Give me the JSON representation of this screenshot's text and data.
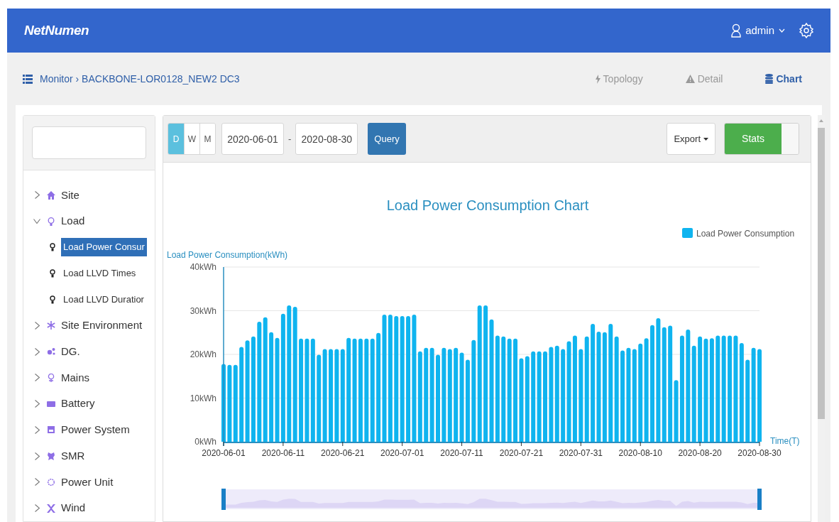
{
  "header": {
    "logo": "NetNumen",
    "user": "admin"
  },
  "breadcrumb": {
    "root": "Monitor",
    "separator": "›",
    "current": "BACKBONE-LOR0128_NEW2 DC3"
  },
  "views": [
    {
      "label": "Topology",
      "selected": false
    },
    {
      "label": "Detail",
      "selected": false
    },
    {
      "label": "Chart",
      "selected": true
    }
  ],
  "tree": [
    {
      "label": "Site",
      "expanded": false
    },
    {
      "label": "Load",
      "expanded": true,
      "children": [
        {
          "label": "Load Power Consur",
          "selected": true
        },
        {
          "label": "Load LLVD Times",
          "selected": false
        },
        {
          "label": "Load LLVD Duratior",
          "selected": false
        }
      ]
    },
    {
      "label": "Site Environment",
      "expanded": false
    },
    {
      "label": "DG.",
      "expanded": false
    },
    {
      "label": "Mains",
      "expanded": false
    },
    {
      "label": "Battery",
      "expanded": false
    },
    {
      "label": "Power System",
      "expanded": false
    },
    {
      "label": "SMR",
      "expanded": false
    },
    {
      "label": "Power Unit",
      "expanded": false
    },
    {
      "label": "Wind",
      "expanded": false
    }
  ],
  "periods": [
    {
      "label": "D",
      "selected": true
    },
    {
      "label": "W",
      "selected": false
    },
    {
      "label": "M",
      "selected": false
    }
  ],
  "date_from": "2020-06-01",
  "date_separator": "-",
  "date_to": "2020-08-30",
  "query_button": "Query",
  "export_button": "Export",
  "stats_toggle": {
    "label": "Stats",
    "on": true
  },
  "chart_data": {
    "type": "bar",
    "title": "Load Power Consumption Chart",
    "xlabel": "Time(T)",
    "ylabel": "Load Power Consumption(kWh)",
    "grid": true,
    "categories": [
      "2020-06-01",
      null,
      null,
      null,
      null,
      null,
      null,
      null,
      null,
      null,
      "2020-06-11",
      null,
      null,
      null,
      null,
      null,
      null,
      null,
      null,
      null,
      "2020-06-21",
      null,
      null,
      null,
      null,
      null,
      null,
      null,
      null,
      null,
      "2020-07-01",
      null,
      null,
      null,
      null,
      null,
      null,
      null,
      null,
      null,
      "2020-07-11",
      null,
      null,
      null,
      null,
      null,
      null,
      null,
      null,
      null,
      "2020-07-21",
      null,
      null,
      null,
      null,
      null,
      null,
      null,
      null,
      null,
      "2020-07-31",
      null,
      null,
      null,
      null,
      null,
      null,
      null,
      null,
      null,
      "2020-08-10",
      null,
      null,
      null,
      null,
      null,
      null,
      null,
      null,
      null,
      "2020-08-20",
      null,
      null,
      null,
      null,
      null,
      null,
      null,
      null,
      null,
      "2020-08-30"
    ],
    "ylim": [
      0,
      40
    ],
    "yticks": [
      {
        "value": 0,
        "label": "0kWh"
      },
      {
        "value": 10,
        "label": "10kWh"
      },
      {
        "value": 20,
        "label": "20kWh"
      },
      {
        "value": 30,
        "label": "30kWh"
      },
      {
        "value": 40,
        "label": "40kWh"
      }
    ],
    "series": [
      {
        "name": "Load Power Consumption",
        "color": "#0fb4ef",
        "values": [
          17.8,
          17.6,
          17.6,
          21.7,
          23.2,
          24.1,
          27.5,
          28.5,
          25.1,
          23.8,
          29.3,
          31.2,
          30.9,
          23.6,
          23.6,
          23.6,
          19.9,
          21.2,
          21.2,
          21.2,
          21.2,
          23.8,
          23.6,
          23.6,
          23.6,
          23.6,
          24.9,
          29.1,
          29.1,
          28.8,
          28.8,
          28.8,
          29.1,
          20.7,
          21.5,
          21.5,
          19.9,
          21.5,
          21.2,
          21.5,
          20.4,
          18.8,
          23.3,
          31.2,
          31.2,
          28,
          24.3,
          24.1,
          23.6,
          23.6,
          19.1,
          19.6,
          20.7,
          20.7,
          20.7,
          21.7,
          22,
          21.2,
          23,
          24.3,
          21.2,
          24.1,
          27,
          25.2,
          25.1,
          27,
          24.1,
          20.9,
          21.5,
          21.2,
          22.5,
          23.7,
          26.7,
          28.3,
          26.2,
          26.6,
          14.1,
          24.3,
          25.7,
          22,
          24.1,
          23.6,
          23.7,
          24.3,
          24.3,
          24.3,
          24.3,
          22.6,
          18.8,
          21.5,
          21.2
        ]
      }
    ]
  }
}
